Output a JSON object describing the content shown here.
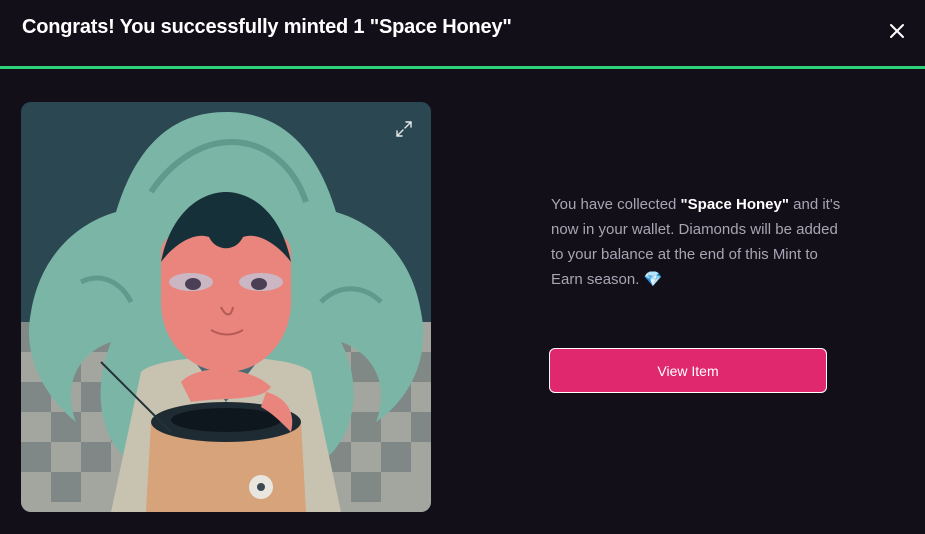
{
  "header": {
    "title": "Congrats! You successfully minted 1 \"Space Honey\"",
    "close_icon": "close-icon"
  },
  "colors": {
    "background": "#130f19",
    "accent_divider": "#2fd07a",
    "button": "#e0286f",
    "text_muted": "#a9a4b3"
  },
  "artwork": {
    "expand_icon": "expand-icon"
  },
  "message": {
    "prefix": "You have collected ",
    "item_name": "\"Space Honey\"",
    "suffix": " and it's now in your wallet. Diamonds will be added to your balance at the end of this Mint to Earn season.",
    "emoji": "💎"
  },
  "actions": {
    "view_item_label": "View Item"
  }
}
